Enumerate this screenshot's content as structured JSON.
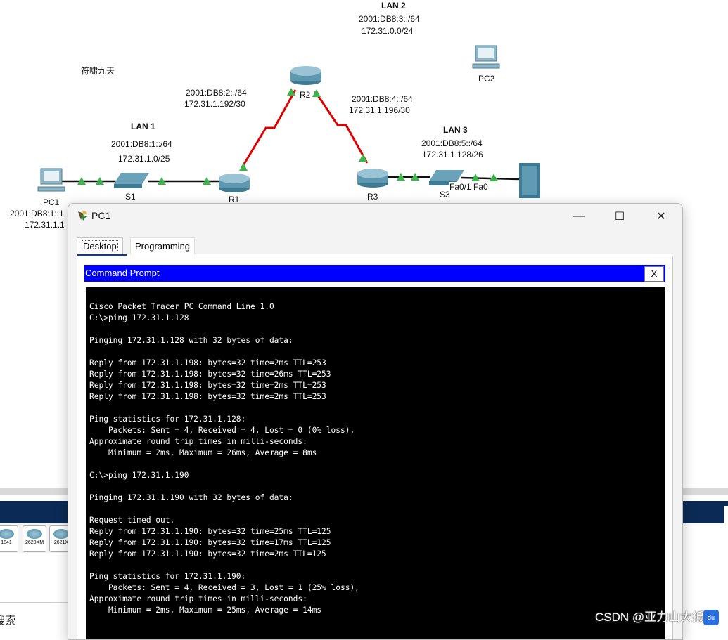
{
  "topology": {
    "lan2": {
      "title": "LAN 2",
      "ipv6": "2001:DB8:3::/64",
      "ipv4": "172.31.0.0/24"
    },
    "pc2_label": "PC2",
    "annotation": "符啸九天",
    "link_r1_r2": {
      "ipv6": "2001:DB8:2::/64",
      "ipv4": "172.31.1.192/30"
    },
    "link_r2_r3": {
      "ipv6": "2001:DB8:4::/64",
      "ipv4": "172.31.1.196/30"
    },
    "r2_label": "R2",
    "lan1": {
      "title": "LAN 1",
      "ipv6": "2001:DB8:1::/64",
      "ipv4": "172.31.1.0/25"
    },
    "lan3": {
      "title": "LAN 3",
      "ipv6": "2001:DB8:5::/64",
      "ipv4": "172.31.1.128/26"
    },
    "pc1_label": "PC1",
    "pc1_ipv6": "2001:DB8:1::1",
    "pc1_ipv4": "172.31.1.1",
    "s1_label": "S1",
    "r1_label": "R1",
    "r3_label": "R3",
    "s3_label": "S3",
    "port_labels": "Fa0/1 Fa0",
    "colors": {
      "serial_link": "#e00000",
      "link_up": "#3cb54a",
      "cable": "#111111"
    }
  },
  "toolbar": {
    "devices": [
      "1841",
      "2620XM",
      "2621X"
    ],
    "search_fragment": "搜索"
  },
  "window": {
    "title": "PC1",
    "minimize_icon": "—",
    "maximize_icon": "☐",
    "close_icon": "✕",
    "tabs": [
      {
        "label": "Desktop",
        "active": true
      },
      {
        "label": "Programming",
        "active": false
      }
    ],
    "command_prompt": {
      "title": "Command Prompt",
      "close_label": "X",
      "lines": [
        "Cisco Packet Tracer PC Command Line 1.0",
        "C:\\>ping 172.31.1.128",
        "",
        "Pinging 172.31.1.128 with 32 bytes of data:",
        "",
        "Reply from 172.31.1.198: bytes=32 time=2ms TTL=253",
        "Reply from 172.31.1.198: bytes=32 time=26ms TTL=253",
        "Reply from 172.31.1.198: bytes=32 time=2ms TTL=253",
        "Reply from 172.31.1.198: bytes=32 time=2ms TTL=253",
        "",
        "Ping statistics for 172.31.1.128:",
        "    Packets: Sent = 4, Received = 4, Lost = 0 (0% loss),",
        "Approximate round trip times in milli-seconds:",
        "    Minimum = 2ms, Maximum = 26ms, Average = 8ms",
        "",
        "C:\\>ping 172.31.1.190",
        "",
        "Pinging 172.31.1.190 with 32 bytes of data:",
        "",
        "Request timed out.",
        "Reply from 172.31.1.190: bytes=32 time=25ms TTL=125",
        "Reply from 172.31.1.190: bytes=32 time=17ms TTL=125",
        "Reply from 172.31.1.190: bytes=32 time=2ms TTL=125",
        "",
        "Ping statistics for 172.31.1.190:",
        "    Packets: Sent = 4, Received = 3, Lost = 1 (25% loss),",
        "Approximate round trip times in milli-seconds:",
        "    Minimum = 2ms, Maximum = 25ms, Average = 14ms"
      ]
    }
  },
  "watermark": "CSDN @亚力山大抵",
  "baidu_badge": "du"
}
